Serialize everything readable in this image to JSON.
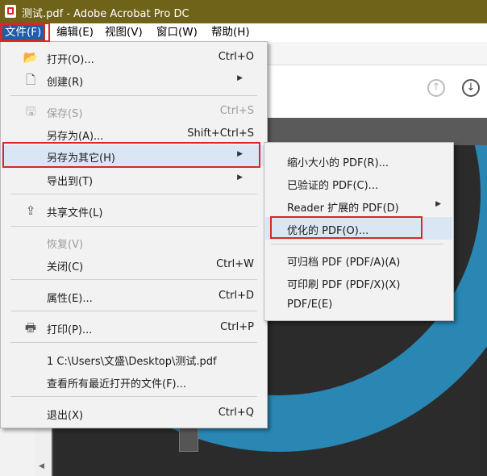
{
  "window": {
    "title": "测试.pdf - Adobe Acrobat Pro DC"
  },
  "menubar": [
    "文件(F)",
    "编辑(E)",
    "视图(V)",
    "窗口(W)",
    "帮助(H)"
  ],
  "file_menu": {
    "open": {
      "label": "打开(O)...",
      "shortcut": "Ctrl+O"
    },
    "create": {
      "label": "创建(R)"
    },
    "save": {
      "label": "保存(S)",
      "shortcut": "Ctrl+S"
    },
    "save_as": {
      "label": "另存为(A)...",
      "shortcut": "Shift+Ctrl+S"
    },
    "save_other": {
      "label": "另存为其它(H)"
    },
    "export": {
      "label": "导出到(T)"
    },
    "share": {
      "label": "共享文件(L)"
    },
    "revert": {
      "label": "恢复(V)"
    },
    "close": {
      "label": "关闭(C)",
      "shortcut": "Ctrl+W"
    },
    "properties": {
      "label": "属性(E)...",
      "shortcut": "Ctrl+D"
    },
    "print": {
      "label": "打印(P)...",
      "shortcut": "Ctrl+P"
    },
    "recent1": {
      "label": "1 C:\\Users\\文盛\\Desktop\\测试.pdf"
    },
    "view_recent": {
      "label": "查看所有最近打开的文件(F)..."
    },
    "exit": {
      "label": "退出(X)",
      "shortcut": "Ctrl+Q"
    }
  },
  "save_other_submenu": {
    "reduced": "缩小大小的 PDF(R)...",
    "certified": "已验证的 PDF(C)...",
    "reader": "Reader 扩展的 PDF(D)",
    "optimized": "优化的 PDF(O)...",
    "archive": "可归档 PDF (PDF/A)(A)",
    "printable": "可印刷 PDF (PDF/X)(X)",
    "pdfe": "PDF/E(E)"
  }
}
